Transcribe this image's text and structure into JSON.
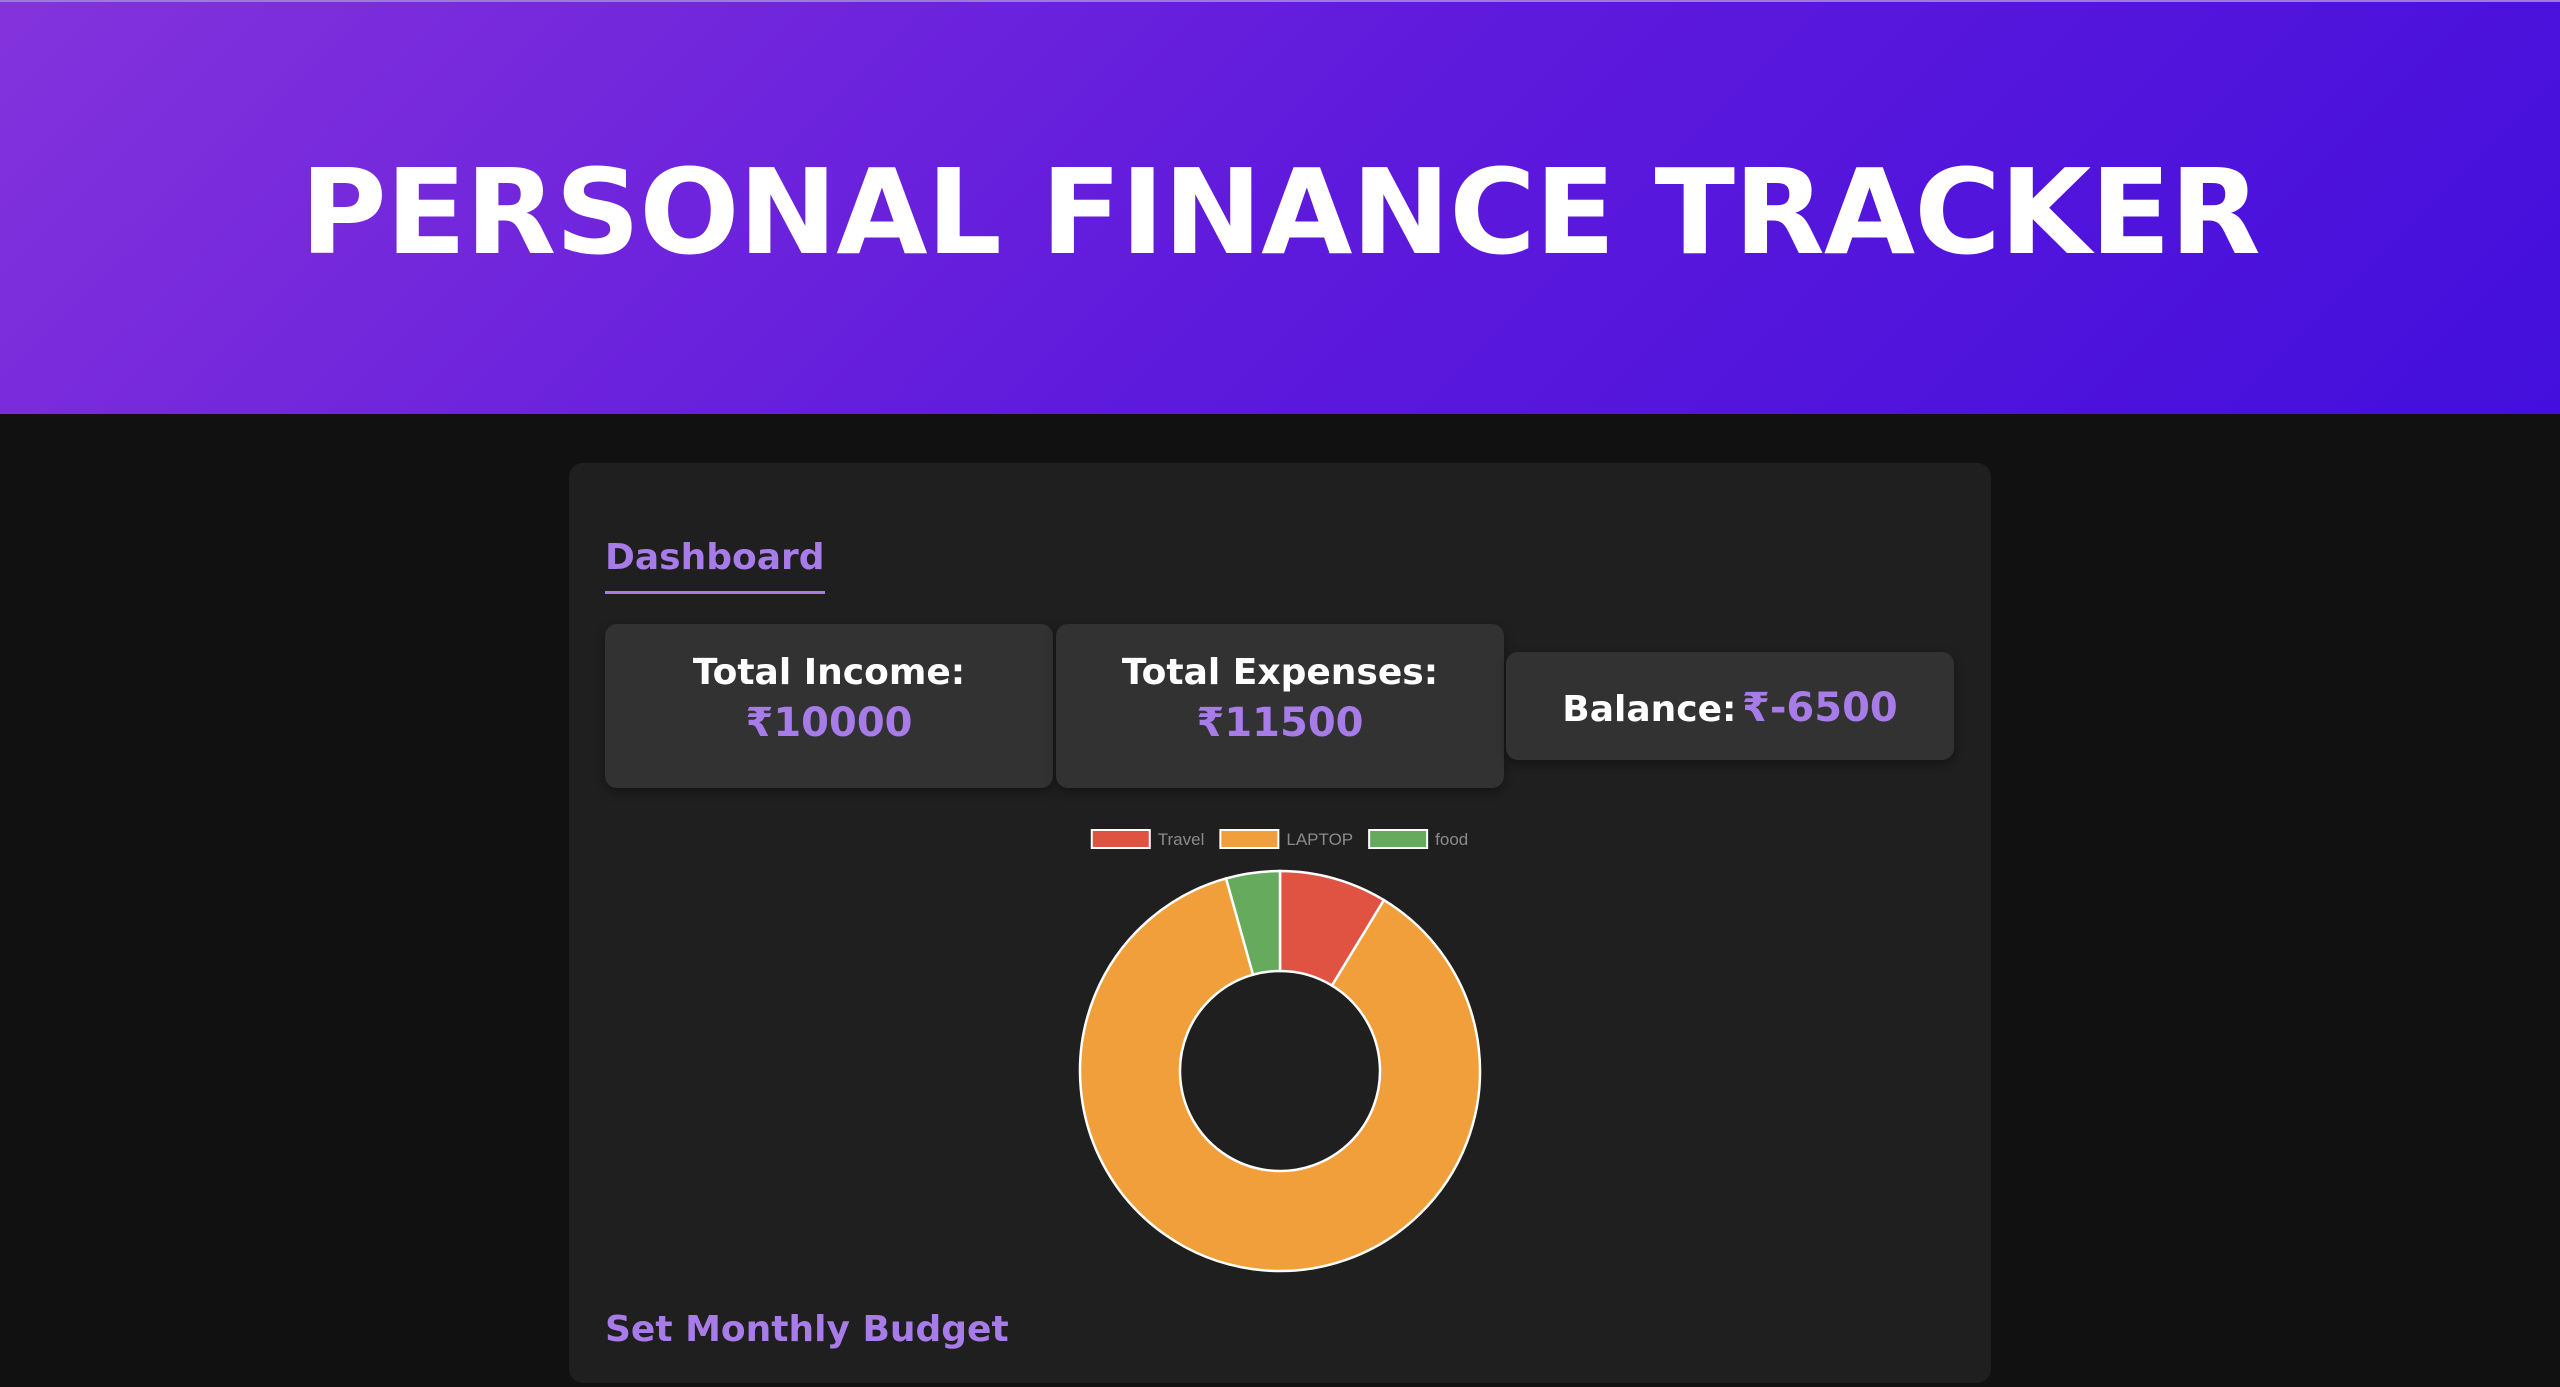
{
  "header": {
    "title": "PERSONAL FINANCE TRACKER"
  },
  "dashboard": {
    "title": "Dashboard",
    "income": {
      "label": "Total Income:",
      "value": "₹10000"
    },
    "expenses": {
      "label": "Total Expenses:",
      "value": "₹11500"
    },
    "balance": {
      "label": "Balance:",
      "value": "₹-6500"
    }
  },
  "budget": {
    "title": "Set Monthly Budget"
  },
  "colors": {
    "accent": "#a77be8",
    "header_start": "#8433dc",
    "header_end": "#430fdc",
    "background": "#111111",
    "card": "#1f1f1f",
    "stat_card": "#323232"
  },
  "chart_data": {
    "type": "pie",
    "variant": "doughnut",
    "legend_position": "top",
    "categories": [
      "Travel",
      "LAPTOP",
      "food"
    ],
    "values": [
      1000,
      10000,
      500
    ],
    "colors": [
      "#e05343",
      "#f19f3a",
      "#66ab5d"
    ]
  }
}
